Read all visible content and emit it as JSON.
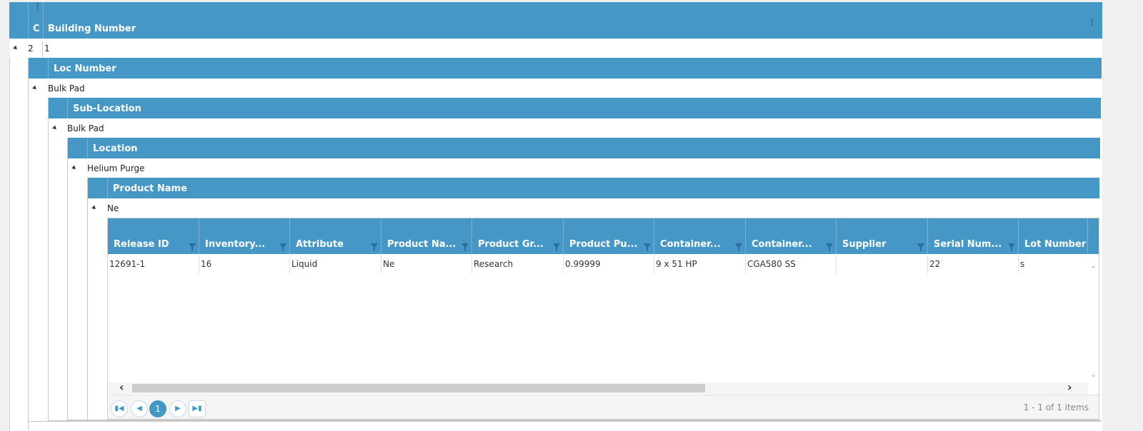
{
  "top": {
    "header_narrow": "C",
    "header_title": "Building Number",
    "row_count": "2",
    "row_value": "1"
  },
  "level2": {
    "header_title": "Loc Number",
    "row_value": "Bulk Pad"
  },
  "level3": {
    "header_title": "Sub-Location",
    "row_value": "Bulk Pad"
  },
  "level4": {
    "header_title": "Location",
    "row_value": "Helium Purge"
  },
  "level5": {
    "header_title": "Product Name",
    "row_value": "Ne"
  },
  "grid": {
    "columns": [
      "Release ID",
      "Inventory...",
      "Attribute",
      "Product Na...",
      "Product Gr...",
      "Product Pu...",
      "Container...",
      "Container...",
      "Supplier",
      "Serial Num...",
      "Lot Number"
    ],
    "rows": [
      [
        "12691-1",
        "16",
        "Liquid",
        "Ne",
        "Research",
        "0.99999",
        "9 x 51 HP",
        "CGA580 SS",
        "",
        "22",
        "s"
      ]
    ]
  },
  "pager": {
    "current_page": "1",
    "summary": "1 - 1 of 1 items",
    "first_icon": "first-page-icon",
    "prev_icon": "prev-page-icon",
    "next_icon": "next-page-icon",
    "last_icon": "last-page-icon"
  },
  "colors": {
    "header_bg": "#4598c6",
    "accent": "#4598c6"
  }
}
